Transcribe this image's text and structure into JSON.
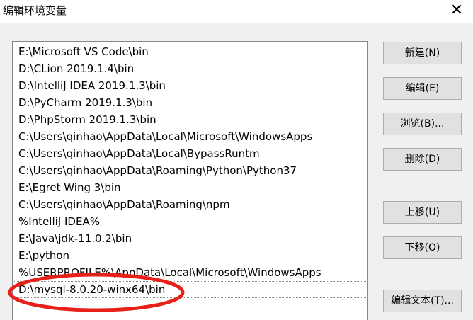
{
  "window": {
    "title": "编辑环境变量",
    "close_glyph": "✕"
  },
  "path_list": {
    "items": [
      "E:\\Microsoft VS Code\\bin",
      "D:\\CLion 2019.1.4\\bin",
      "D:\\IntelliJ IDEA 2019.1.3\\bin",
      "D:\\PyCharm 2019.1.3\\bin",
      "D:\\PhpStorm 2019.1.3\\bin",
      "C:\\Users\\qinhao\\AppData\\Local\\Microsoft\\WindowsApps",
      "C:\\Users\\qinhao\\AppData\\Local\\BypassRuntm",
      "C:\\Users\\qinhao\\AppData\\Roaming\\Python\\Python37",
      "E:\\Egret Wing 3\\bin",
      "C:\\Users\\qinhao\\AppData\\Roaming\\npm",
      "%IntelliJ IDEA%",
      "E:\\Java\\jdk-11.0.2\\bin",
      "E:\\python",
      "%USERPROFILE%\\AppData\\Local\\Microsoft\\WindowsApps",
      "D:\\mysql-8.0.20-winx64\\bin"
    ],
    "highlight_color": "#e8201a"
  },
  "buttons": {
    "new": "新建(N)",
    "edit": "编辑(E)",
    "browse": "浏览(B)...",
    "delete": "删除(D)",
    "move_up": "上移(U)",
    "move_down": "下移(O)",
    "edit_text": "编辑文本(T)..."
  }
}
